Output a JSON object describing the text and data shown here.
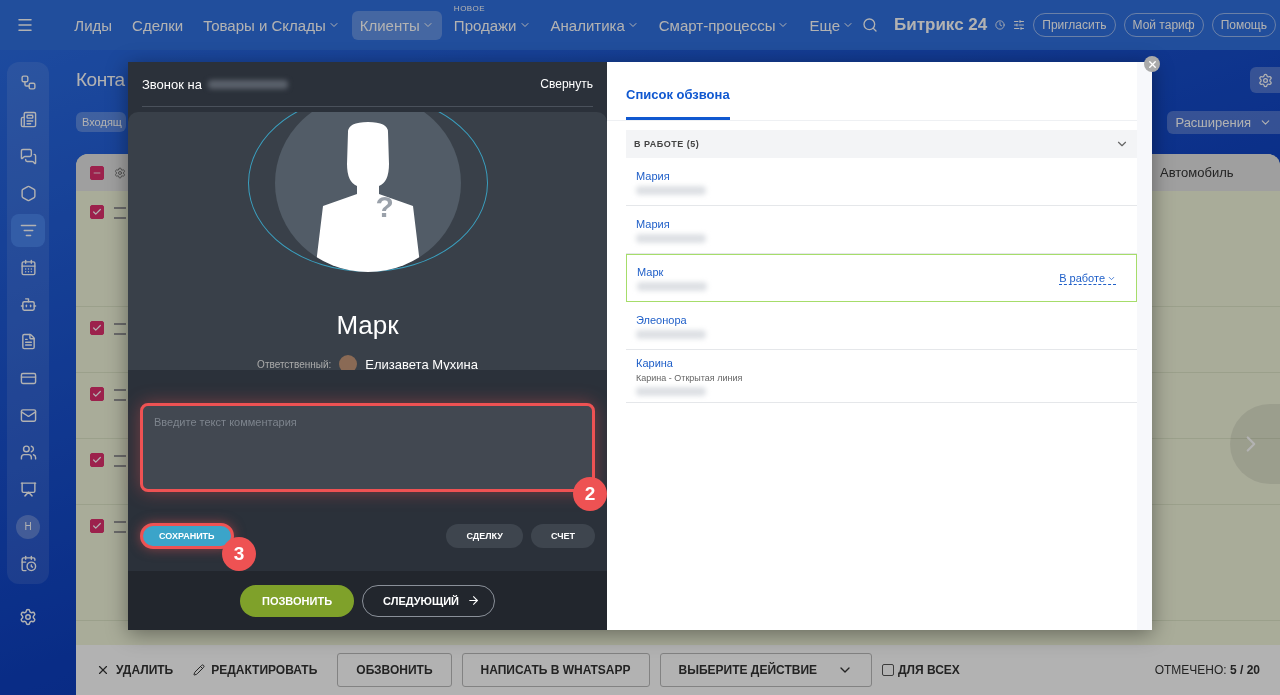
{
  "topnav": {
    "items": [
      {
        "label": "Лиды",
        "dropdown": false,
        "selected": false
      },
      {
        "label": "Сделки",
        "dropdown": false,
        "selected": false
      },
      {
        "label": "Товары и Склады",
        "dropdown": true,
        "selected": false
      },
      {
        "label": "Клиенты",
        "dropdown": true,
        "selected": true
      },
      {
        "label": "Продажи",
        "dropdown": true,
        "selected": false,
        "badge": "НОВОЕ"
      },
      {
        "label": "Аналитика",
        "dropdown": true,
        "selected": false
      },
      {
        "label": "Смарт-процессы",
        "dropdown": true,
        "selected": false
      },
      {
        "label": "Еще",
        "dropdown": true,
        "selected": false
      }
    ],
    "logo": "Битрикс",
    "logo_number": "24",
    "buttons": [
      "Пригласить",
      "Мой тариф",
      "Помощь"
    ]
  },
  "sidebar": {
    "items": [
      {
        "kind": "icon",
        "selected": false
      },
      {
        "kind": "icon",
        "selected": false
      },
      {
        "kind": "icon",
        "selected": false
      },
      {
        "kind": "icon",
        "selected": false
      },
      {
        "kind": "icon",
        "selected": true
      },
      {
        "kind": "icon",
        "selected": false
      },
      {
        "kind": "icon",
        "selected": false
      },
      {
        "kind": "icon",
        "selected": false
      },
      {
        "kind": "icon",
        "selected": false
      },
      {
        "kind": "icon",
        "selected": false
      },
      {
        "kind": "icon",
        "selected": false
      },
      {
        "kind": "icon",
        "selected": false
      },
      {
        "kind": "avatar",
        "initial": "Н",
        "selected": false
      },
      {
        "kind": "icon",
        "selected": false
      }
    ]
  },
  "page": {
    "title": "Конта",
    "filter": "Входящ",
    "extensions_button": "Расширения"
  },
  "table": {
    "header_partial": true,
    "column": "Автомобиль",
    "rows": [
      {
        "checked": true
      },
      {
        "checked": true
      },
      {
        "checked": true
      },
      {
        "checked": true
      },
      {
        "checked": true
      }
    ]
  },
  "bottom_bar": {
    "delete": "УДАЛИТЬ",
    "edit": "РЕДАКТИРОВАТЬ",
    "buttons": [
      "ОБЗВОНИТЬ",
      "НАПИСАТЬ В WHATSAPP"
    ],
    "action_select": "ВЫБЕРИТЕ ДЕЙСТВИЕ",
    "for_all": {
      "label": "ДЛЯ ВСЕХ",
      "checked": false
    },
    "selected_label": "ОТМЕЧЕНО:",
    "selected_value": "5 / 20"
  },
  "call_dialog": {
    "header": "Звонок на",
    "collapse": "Свернуть",
    "avatar_mark": "?",
    "contact_name": "Марк",
    "responsible_label": "Ответственный:",
    "responsible_name": "Елизавета Мухина",
    "comment_placeholder": "Введите текст комментария",
    "save": "СОХРАНИТЬ",
    "create_buttons": [
      "СДЕЛКУ",
      "СЧЕТ"
    ],
    "call": "ПОЗВОНИТЬ",
    "next": "СЛЕДУЮЩИЙ",
    "annotations": [
      {
        "label": "2"
      },
      {
        "label": "3"
      }
    ]
  },
  "call_list": {
    "tab": "Список обзвона",
    "group": {
      "title": "В РАБОТЕ (5)",
      "expanded": true
    },
    "items": [
      {
        "name": "Мария",
        "selected": false
      },
      {
        "name": "Мария",
        "selected": false
      },
      {
        "name": "Марк",
        "selected": true,
        "status": "В работе"
      },
      {
        "name": "Элеонора",
        "selected": false
      },
      {
        "name": "Карина",
        "selected": false,
        "subtitle": "Карина - Открытая линия"
      }
    ]
  }
}
